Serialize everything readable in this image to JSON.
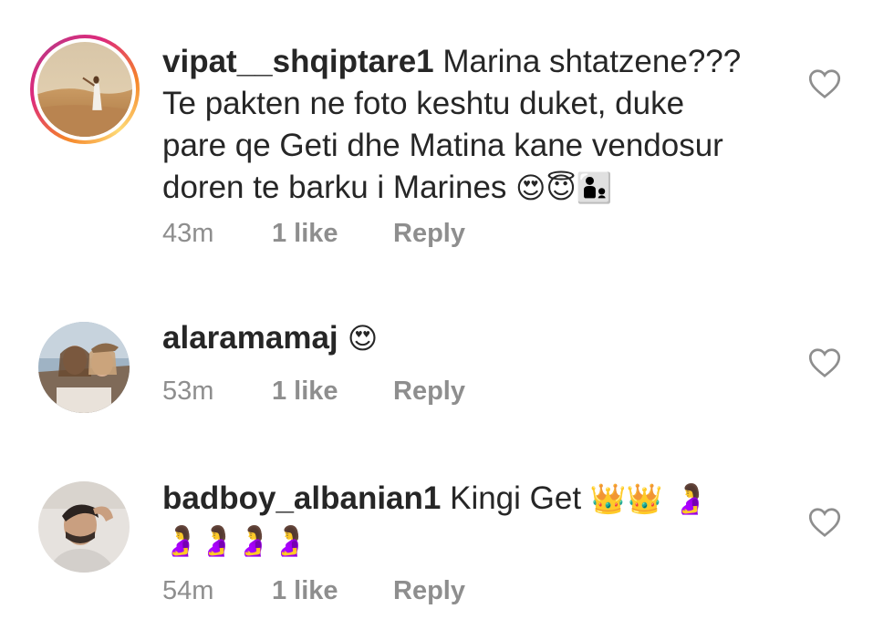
{
  "comments": [
    {
      "username": "vipat__shqiptare1",
      "text_line1": " Marina shtatzene???",
      "text_line2": "Te pakten ne foto keshtu duket, duke",
      "text_line3": "pare qe Geti dhe Matina kane vendosur",
      "text_line4": "doren te barku i Marines ",
      "emoji": "😍😇👨‍👦",
      "time": "43m",
      "likes": "1 like",
      "reply": "Reply",
      "avatar_icon": "desert-photo-avatar",
      "has_story_ring": true
    },
    {
      "username": "alaramamaj",
      "emoji": " 😍",
      "time": "53m",
      "likes": "1 like",
      "reply": "Reply",
      "avatar_icon": "selfie-photo-avatar"
    },
    {
      "username": "badboy_albanian1",
      "text": " Kingi Get ",
      "emoji_line1": "👑👑 🤰",
      "emoji_line2": "🤰🤰🤰🤰",
      "time": "54m",
      "likes": "1 like",
      "reply": "Reply",
      "avatar_icon": "man-photo-avatar"
    }
  ],
  "colors": {
    "text": "#262626",
    "meta": "#8e8e8e",
    "heart_outline": "#8e8e8e"
  }
}
